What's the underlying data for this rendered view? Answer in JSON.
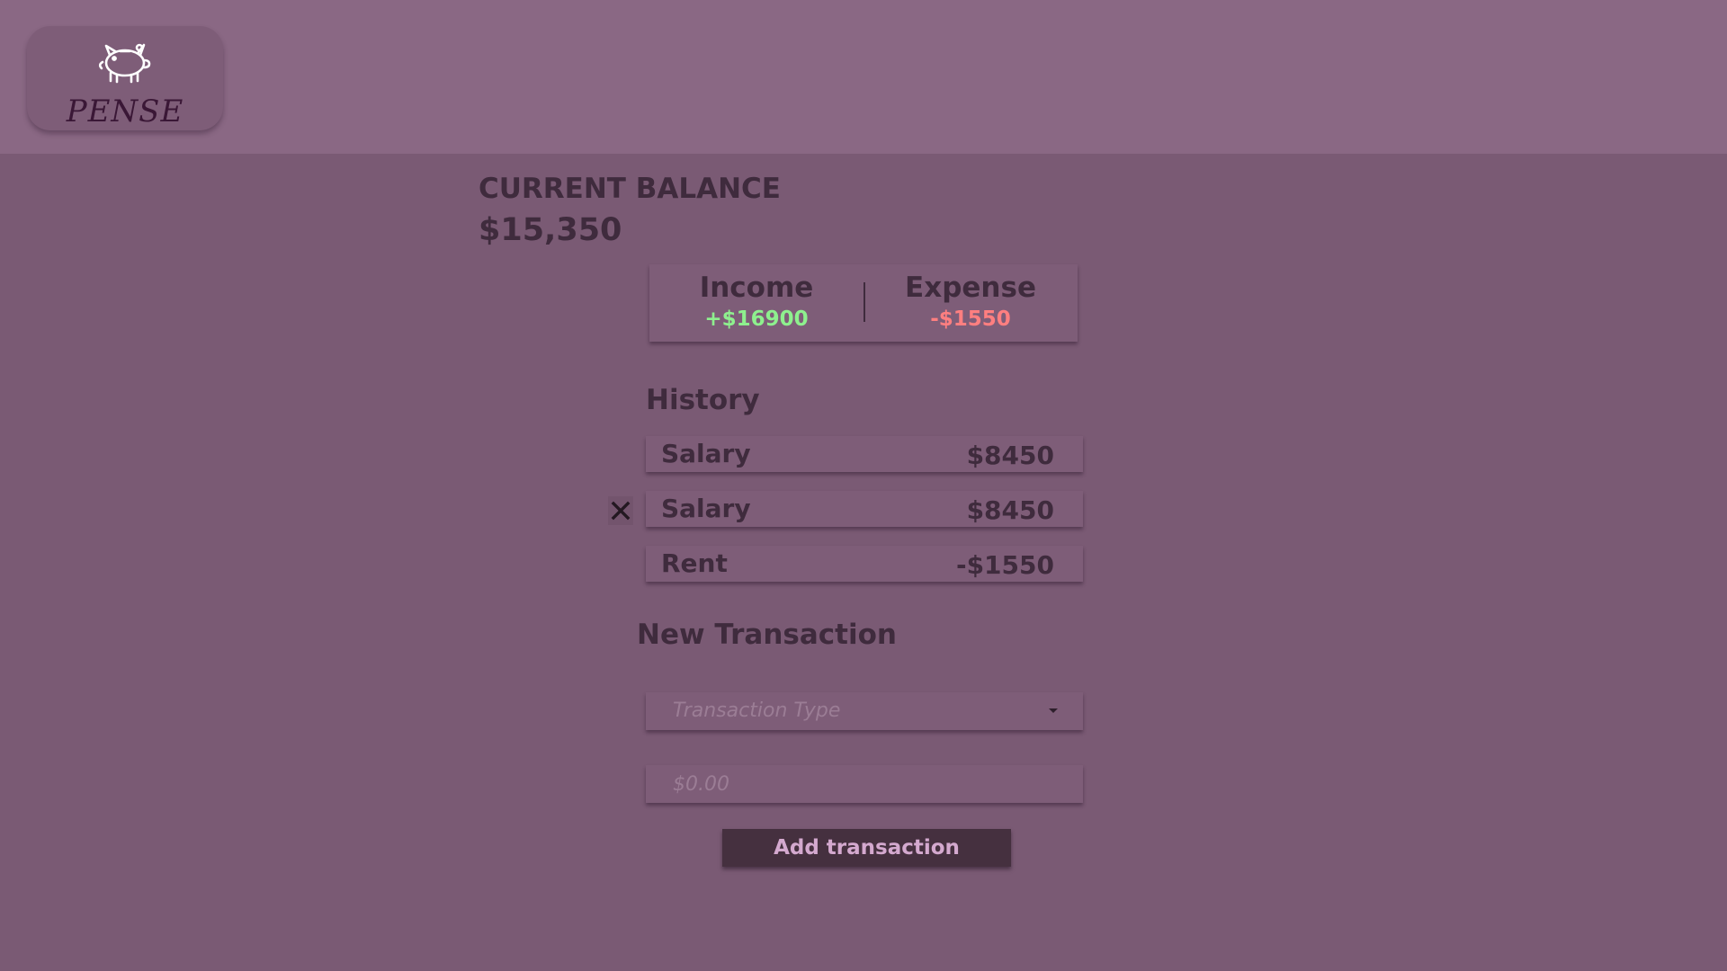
{
  "header": {
    "logo_text": "PENSE",
    "logo_icon": "piggy-bank-icon"
  },
  "balance": {
    "label": "CURRENT BALANCE",
    "value": "$15,350"
  },
  "summary": {
    "income_label": "Income",
    "income_value": "+$16900",
    "expense_label": "Expense",
    "expense_value": "-$1550",
    "income_color": "#8ef08e",
    "expense_color": "#ff7f80"
  },
  "history": {
    "title": "History",
    "items": [
      {
        "name": "Salary",
        "amount": "$8450"
      },
      {
        "name": "Salary",
        "amount": "$8450"
      },
      {
        "name": "Rent",
        "amount": "-$1550"
      }
    ],
    "delete_icon": "close-icon"
  },
  "new_transaction": {
    "title": "New Transaction",
    "type_placeholder": "Transaction Type",
    "amount_placeholder": "$0.00",
    "submit_label": "Add transaction"
  }
}
